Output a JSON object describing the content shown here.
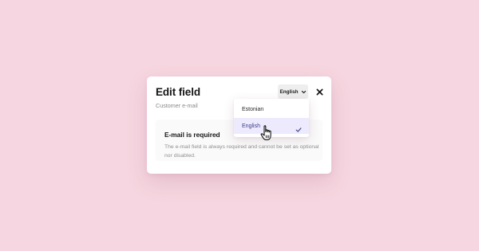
{
  "modal": {
    "title": "Edit field",
    "subtitle": "Customer e-mail",
    "language_button_label": "English",
    "notice": {
      "title": "E-mail is required",
      "body": "The e-mail field is always required and cannot be set as optional nor disabled."
    }
  },
  "dropdown": {
    "options": [
      {
        "label": "Estonian",
        "selected": false
      },
      {
        "label": "English",
        "selected": true
      }
    ]
  },
  "icons": {
    "language_chevron": "chevron-down-icon",
    "close": "close-icon",
    "selected_check": "check-icon",
    "pointer": "hand-pointer-icon"
  },
  "colors": {
    "background": "#f6d6e0",
    "modal": "#ffffff",
    "selected_option": "#eceafc",
    "selected_text": "#3b3b8a",
    "check": "#4c4c8a"
  }
}
